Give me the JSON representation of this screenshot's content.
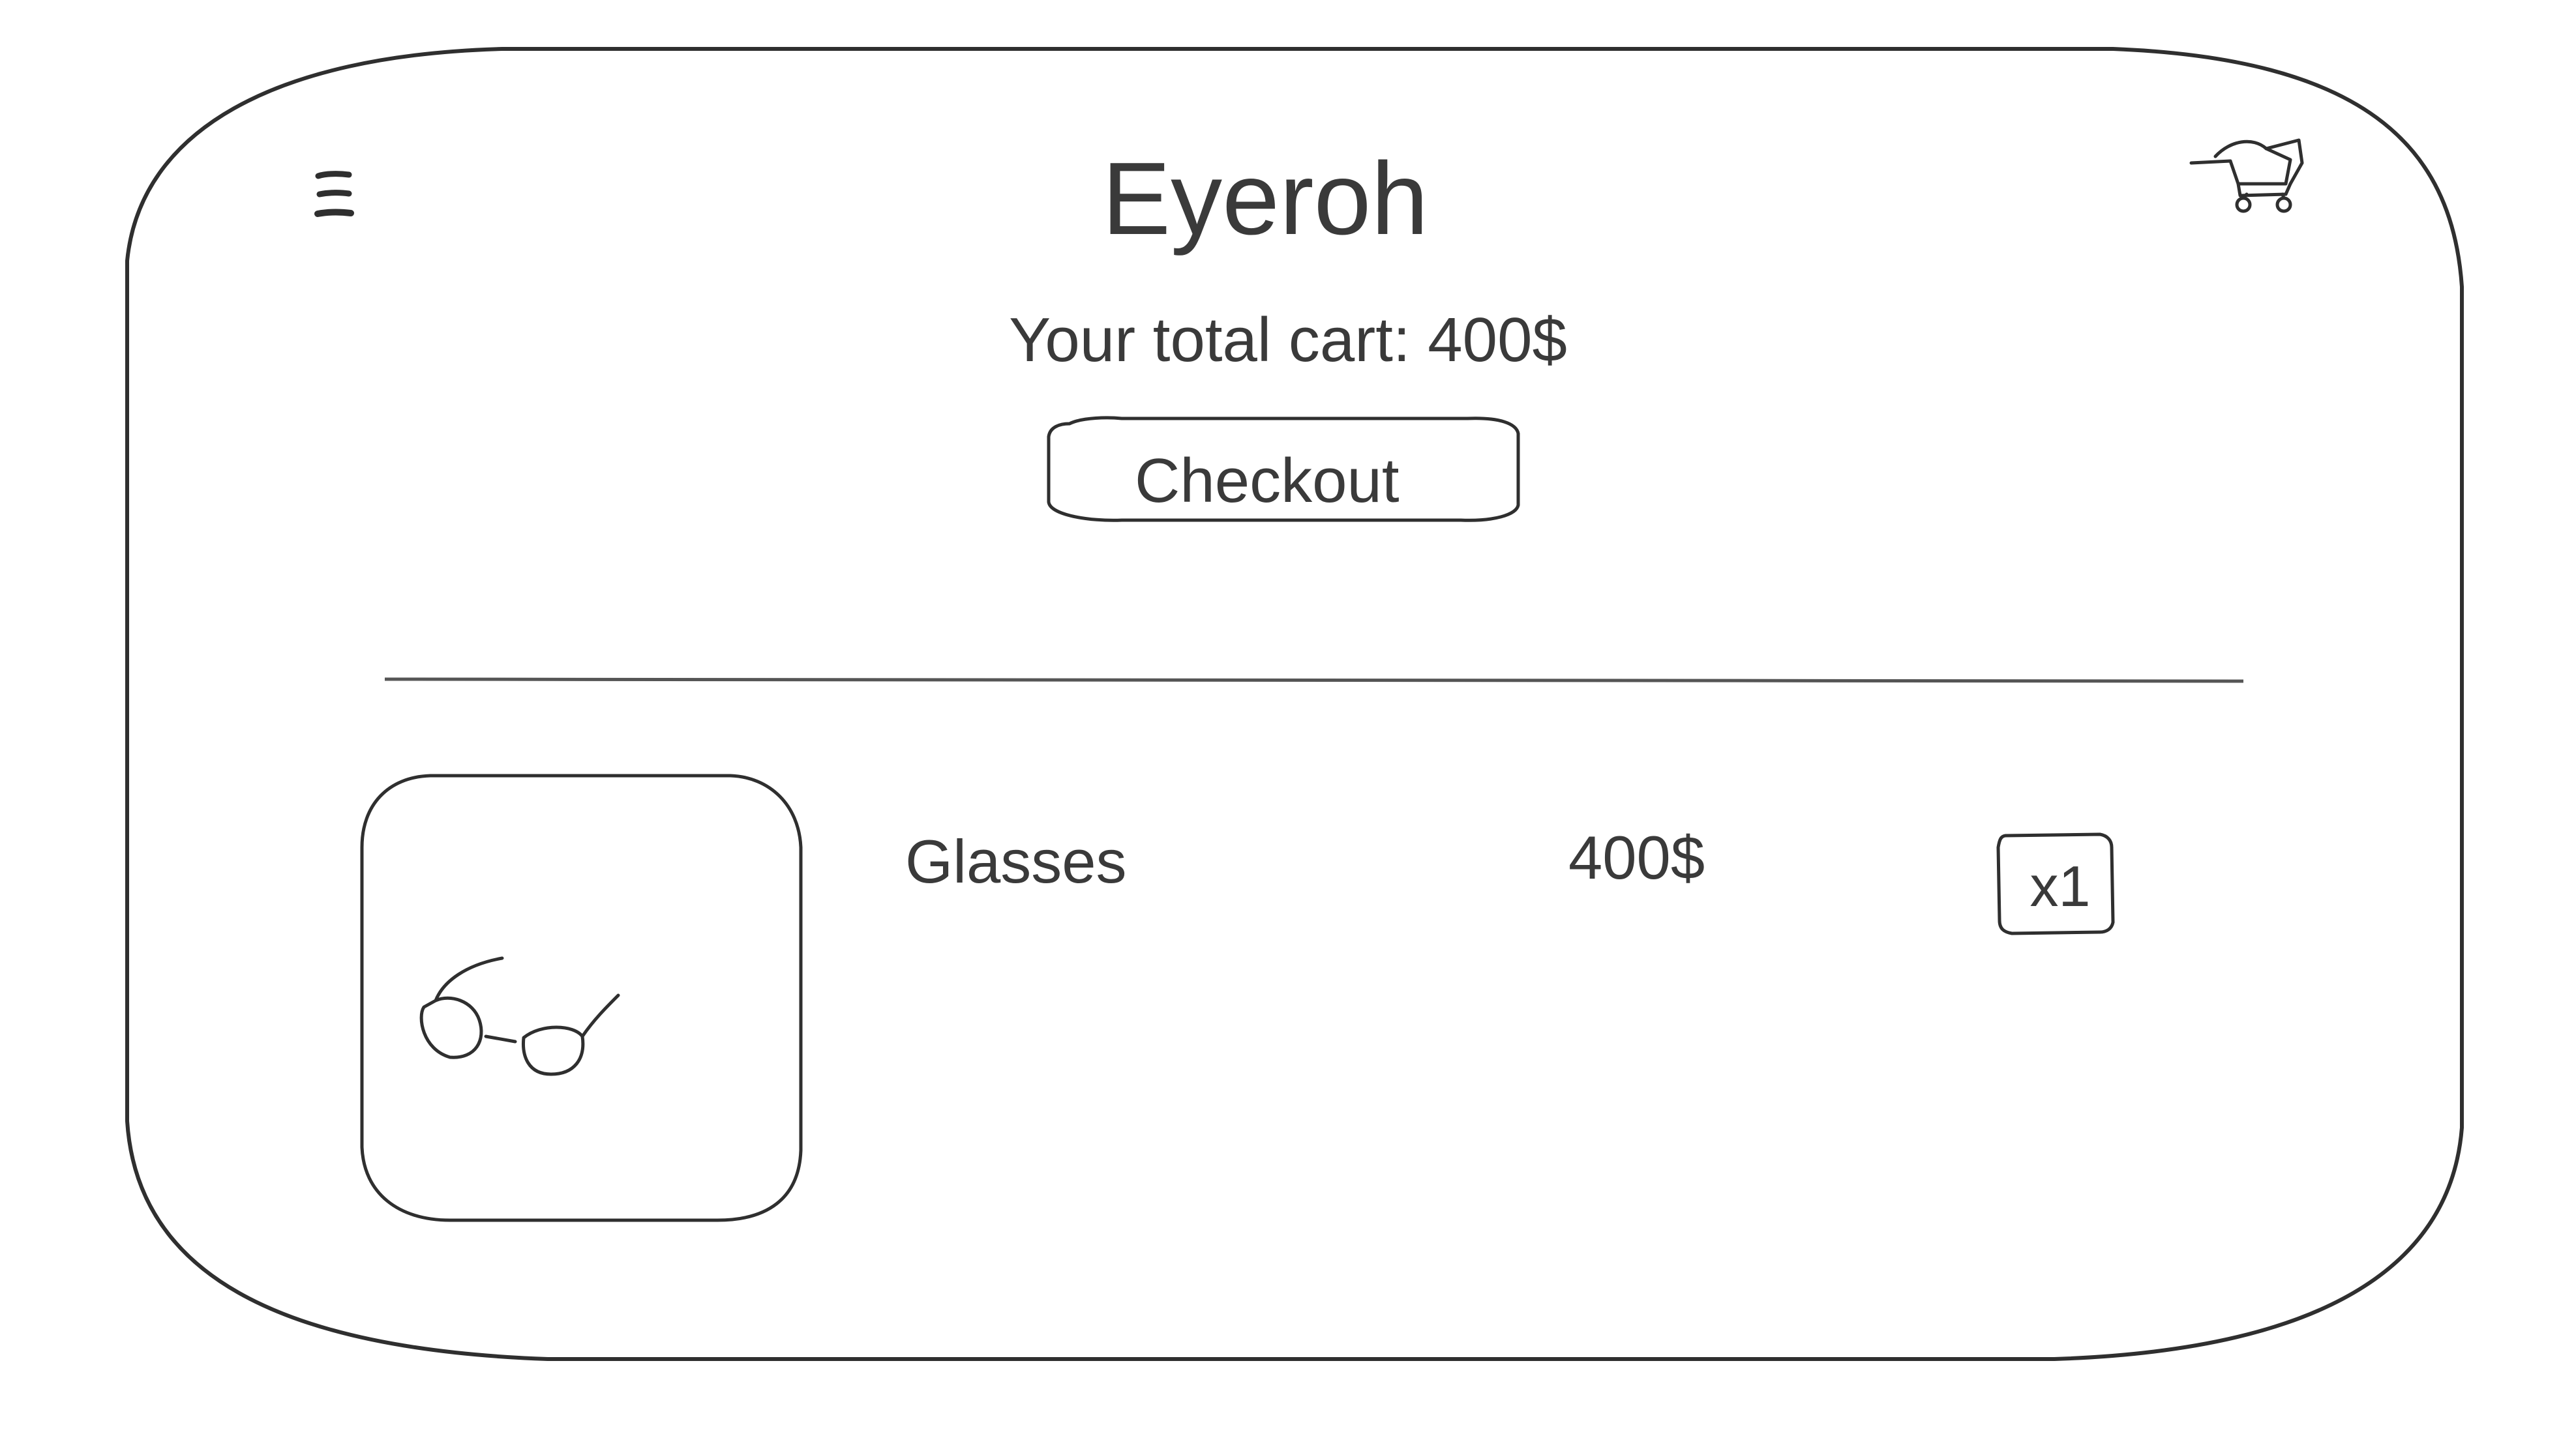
{
  "header": {
    "title": "Eyeroh",
    "menu_icon": "hamburger-menu-icon",
    "cart_icon": "shopping-cart-icon"
  },
  "summary": {
    "total_text": "Your total cart: 400$",
    "checkout_label": "Checkout"
  },
  "cart_items": [
    {
      "name": "Glasses",
      "price": "400$",
      "quantity": "x1",
      "image_icon": "glasses-icon"
    }
  ],
  "colors": {
    "stroke": "#2f2f2f",
    "text": "#3a3a3a",
    "background": "#ffffff"
  }
}
